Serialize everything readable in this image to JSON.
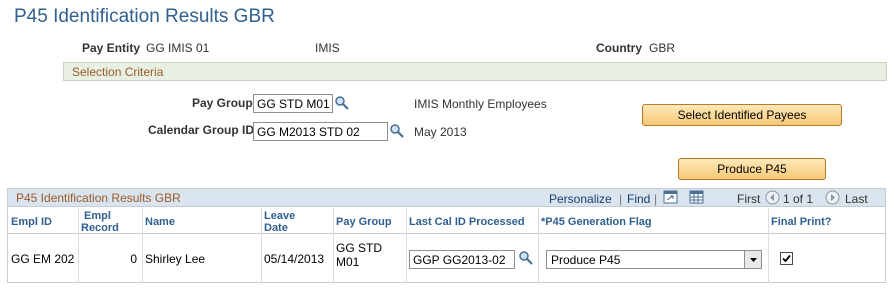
{
  "page": {
    "title": "P45 Identification Results GBR"
  },
  "header": {
    "pay_entity_label": "Pay Entity",
    "pay_entity_code": "GG IMIS 01",
    "pay_entity_name": "IMIS",
    "country_label": "Country",
    "country_value": "GBR"
  },
  "selection": {
    "section_label": "Selection Criteria",
    "pay_group_label": "Pay Group",
    "pay_group_value": "GG STD M01",
    "pay_group_desc": "IMIS Monthly Employees",
    "cal_group_label": "Calendar Group ID",
    "cal_group_value": "GG M2013 STD 02",
    "cal_group_desc": "May 2013",
    "select_button": "Select Identified Payees",
    "produce_button": "Produce P45"
  },
  "grid": {
    "title": "P45 Identification Results GBR",
    "personalize": "Personalize",
    "find": "Find",
    "first": "First",
    "range": "1 of 1",
    "last": "Last",
    "columns": {
      "empl_id": "Empl ID",
      "empl_record_1": "Empl",
      "empl_record_2": "Record",
      "name": "Name",
      "leave_date_1": "Leave",
      "leave_date_2": "Date",
      "pay_group": "Pay Group",
      "last_cal_id": "Last Cal ID Processed",
      "p45_flag": "*P45 Generation Flag",
      "final_print": "Final Print?"
    },
    "row": {
      "empl_id": "GG EM 202",
      "empl_record": "0",
      "name": "Shirley Lee",
      "leave_date": "05/14/2013",
      "pay_group_1": "GG STD",
      "pay_group_2": "M01",
      "last_cal_id": "GGP GG2013-02",
      "p45_flag": "Produce P45",
      "final_print_checked": true
    }
  },
  "icons": {
    "lookup": "magnifier-icon",
    "zoom": "zoom-icon",
    "download": "download-icon"
  },
  "colors": {
    "title": "#2f5f8f",
    "section_text": "#9a5a28",
    "button_bg": "#f7c877"
  }
}
